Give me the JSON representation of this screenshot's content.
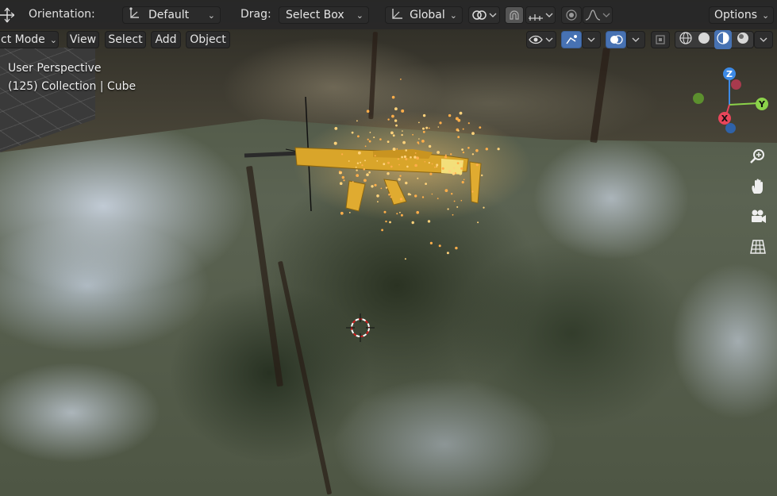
{
  "header": {
    "orientation_label": "Orientation:",
    "orientation_value": "Default",
    "drag_label": "Drag:",
    "drag_value": "Select Box",
    "transform_pivot_value": "Global",
    "options_label": "Options"
  },
  "menu": {
    "mode_value": "ct Mode",
    "view_label": "View",
    "select_label": "Select",
    "add_label": "Add",
    "object_label": "Object"
  },
  "overlay": {
    "perspective_text": "User Perspective",
    "collection_text": "(125) Collection | Cube"
  },
  "gizmo": {
    "z_label": "Z",
    "y_label": "Y",
    "x_label": "X",
    "colors": {
      "x": "#e8455a",
      "y": "#8bd24a",
      "z": "#3d8ae6"
    }
  },
  "icons": {
    "transform": "transform-icon",
    "pivot": "pivot-icon",
    "link": "link-icon",
    "snap": "snap-icon",
    "snap_increment": "snap-increment-icon",
    "proportional": "proportional-editing-icon",
    "falloff": "falloff-curve-icon",
    "visibility": "eye-icon",
    "gizmo_toggle": "gizmo-icon",
    "overlay": "overlay-icon",
    "xray": "xray-icon",
    "shading_wire": "wireframe-shading-icon",
    "shading_solid": "solid-shading-icon",
    "shading_material": "material-shading-icon",
    "shading_render": "render-shading-icon",
    "zoom": "zoom-icon",
    "pan": "hand-icon",
    "camera": "camera-icon",
    "grid": "grid-icon",
    "cursor": "3d-cursor-icon"
  }
}
